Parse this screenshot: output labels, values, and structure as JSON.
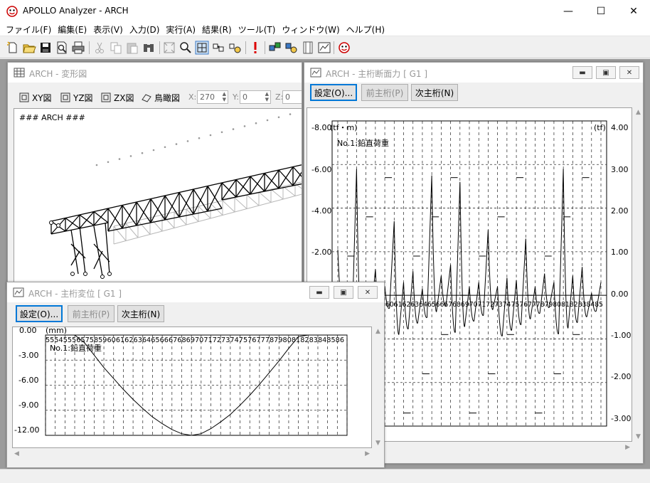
{
  "window": {
    "title": "APOLLO Analyzer - ARCH",
    "minimize": "—",
    "maximize": "☐",
    "close": "✕"
  },
  "menu": [
    "ファイル(F)",
    "編集(E)",
    "表示(V)",
    "入力(D)",
    "実行(A)",
    "結果(R)",
    "ツール(T)",
    "ウィンドウ(W)",
    "ヘルプ(H)"
  ],
  "toolbar": {
    "icons": [
      "new-icon",
      "open-icon",
      "save-icon",
      "print-preview-icon",
      "print-icon",
      "cut-icon",
      "copy-icon",
      "paste-icon",
      "find-icon",
      "fit-icon",
      "zoom-icon",
      "zoom-window-icon",
      "model-icon",
      "result-icon",
      "execute-icon",
      "member-icon",
      "load-icon",
      "film-icon",
      "graph-icon",
      "help-icon"
    ]
  },
  "deform": {
    "title": "ARCH - 変形図",
    "views": [
      "XY図",
      "YZ図",
      "ZX図",
      "鳥瞰図"
    ],
    "x_label": "X:",
    "x_value": "270",
    "y_label": "Y:",
    "y_value": "0",
    "z_label": "Z:",
    "z_value": "0",
    "model_label": "### ARCH ###"
  },
  "force": {
    "title": "ARCH - 主桁断面力 [ G1 ]",
    "btn_settings": "設定(O)...",
    "btn_prev": "前主桁(P)",
    "btn_next": "次主桁(N)",
    "left_unit": "(tf・m)",
    "right_unit": "(tf)",
    "legend": "No.1:鉛直荷重",
    "left_ticks": [
      "-8.00",
      "-6.00",
      "-4.00",
      "-2.00"
    ],
    "right_ticks": [
      "4.00",
      "3.00",
      "2.00",
      "1.00",
      "0.00",
      "-1.00",
      "-2.00",
      "-3.00"
    ],
    "node_labels": "6061626364656667686970717273747576777879808182838485"
  },
  "disp": {
    "title": "ARCH - 主桁変位 [ G1 ]",
    "btn_settings": "設定(O)...",
    "btn_prev": "前主桁(P)",
    "btn_next": "次主桁(N)",
    "unit": "(mm)",
    "legend": "No.1:鉛直荷重",
    "y_ticks": [
      "0.00",
      "-3.00",
      "-6.00",
      "-9.00",
      "-12.00"
    ],
    "node_labels": "55545556575859606162636465666768697071727374757677787980818283848586"
  },
  "chart_data": [
    {
      "type": "line",
      "title": "",
      "legend": [
        "No.1:鉛直荷重"
      ],
      "ylabel": "(tf・m)",
      "y2label": "(tf)",
      "ylim": [
        -8,
        0
      ],
      "y2lim": [
        -3,
        4
      ],
      "x": [
        57,
        58,
        59,
        60,
        61,
        62,
        63,
        64,
        65,
        66,
        67,
        68,
        69,
        70,
        71,
        72,
        73,
        74,
        75,
        76,
        77,
        78,
        79,
        80,
        81,
        82,
        83,
        84,
        85
      ],
      "series": [
        {
          "name": "No.1:鉛直荷重",
          "values": [
            -2.1,
            -0.3,
            -5.8,
            -0.3,
            -1.2,
            -0.4,
            -3.4,
            -0.6,
            -1.1,
            -0.3,
            -5.5,
            -0.9,
            -1.4,
            -5.2,
            -0.4,
            -0.6,
            -3.0,
            -0.4,
            -0.8,
            -0.7,
            -2.6,
            -0.4,
            -1.0,
            -0.6,
            -5.8,
            -0.9,
            -1.3,
            -0.1,
            -0.6
          ]
        }
      ]
    },
    {
      "type": "line",
      "title": "",
      "legend": [
        "No.1:鉛直荷重"
      ],
      "ylabel": "(mm)",
      "ylim": [
        -12,
        0
      ],
      "x": [
        55,
        56,
        57,
        58,
        59,
        60,
        61,
        62,
        63,
        64,
        65,
        66,
        67,
        68,
        69,
        70,
        71,
        72,
        73,
        74,
        75,
        76,
        77,
        78,
        79,
        80,
        81,
        82,
        83,
        84,
        85,
        86
      ],
      "series": [
        {
          "name": "No.1:鉛直荷重",
          "values": [
            0,
            0,
            0,
            0,
            -0.9,
            -2.4,
            -3.9,
            -5.2,
            -6.5,
            -7.7,
            -8.8,
            -9.8,
            -10.6,
            -11.3,
            -11.8,
            -12.0,
            -11.8,
            -11.2,
            -10.4,
            -9.5,
            -8.4,
            -7.2,
            -5.9,
            -4.5,
            -3.1,
            -1.6,
            -0.2,
            0,
            0,
            0,
            0,
            0
          ]
        }
      ]
    }
  ]
}
